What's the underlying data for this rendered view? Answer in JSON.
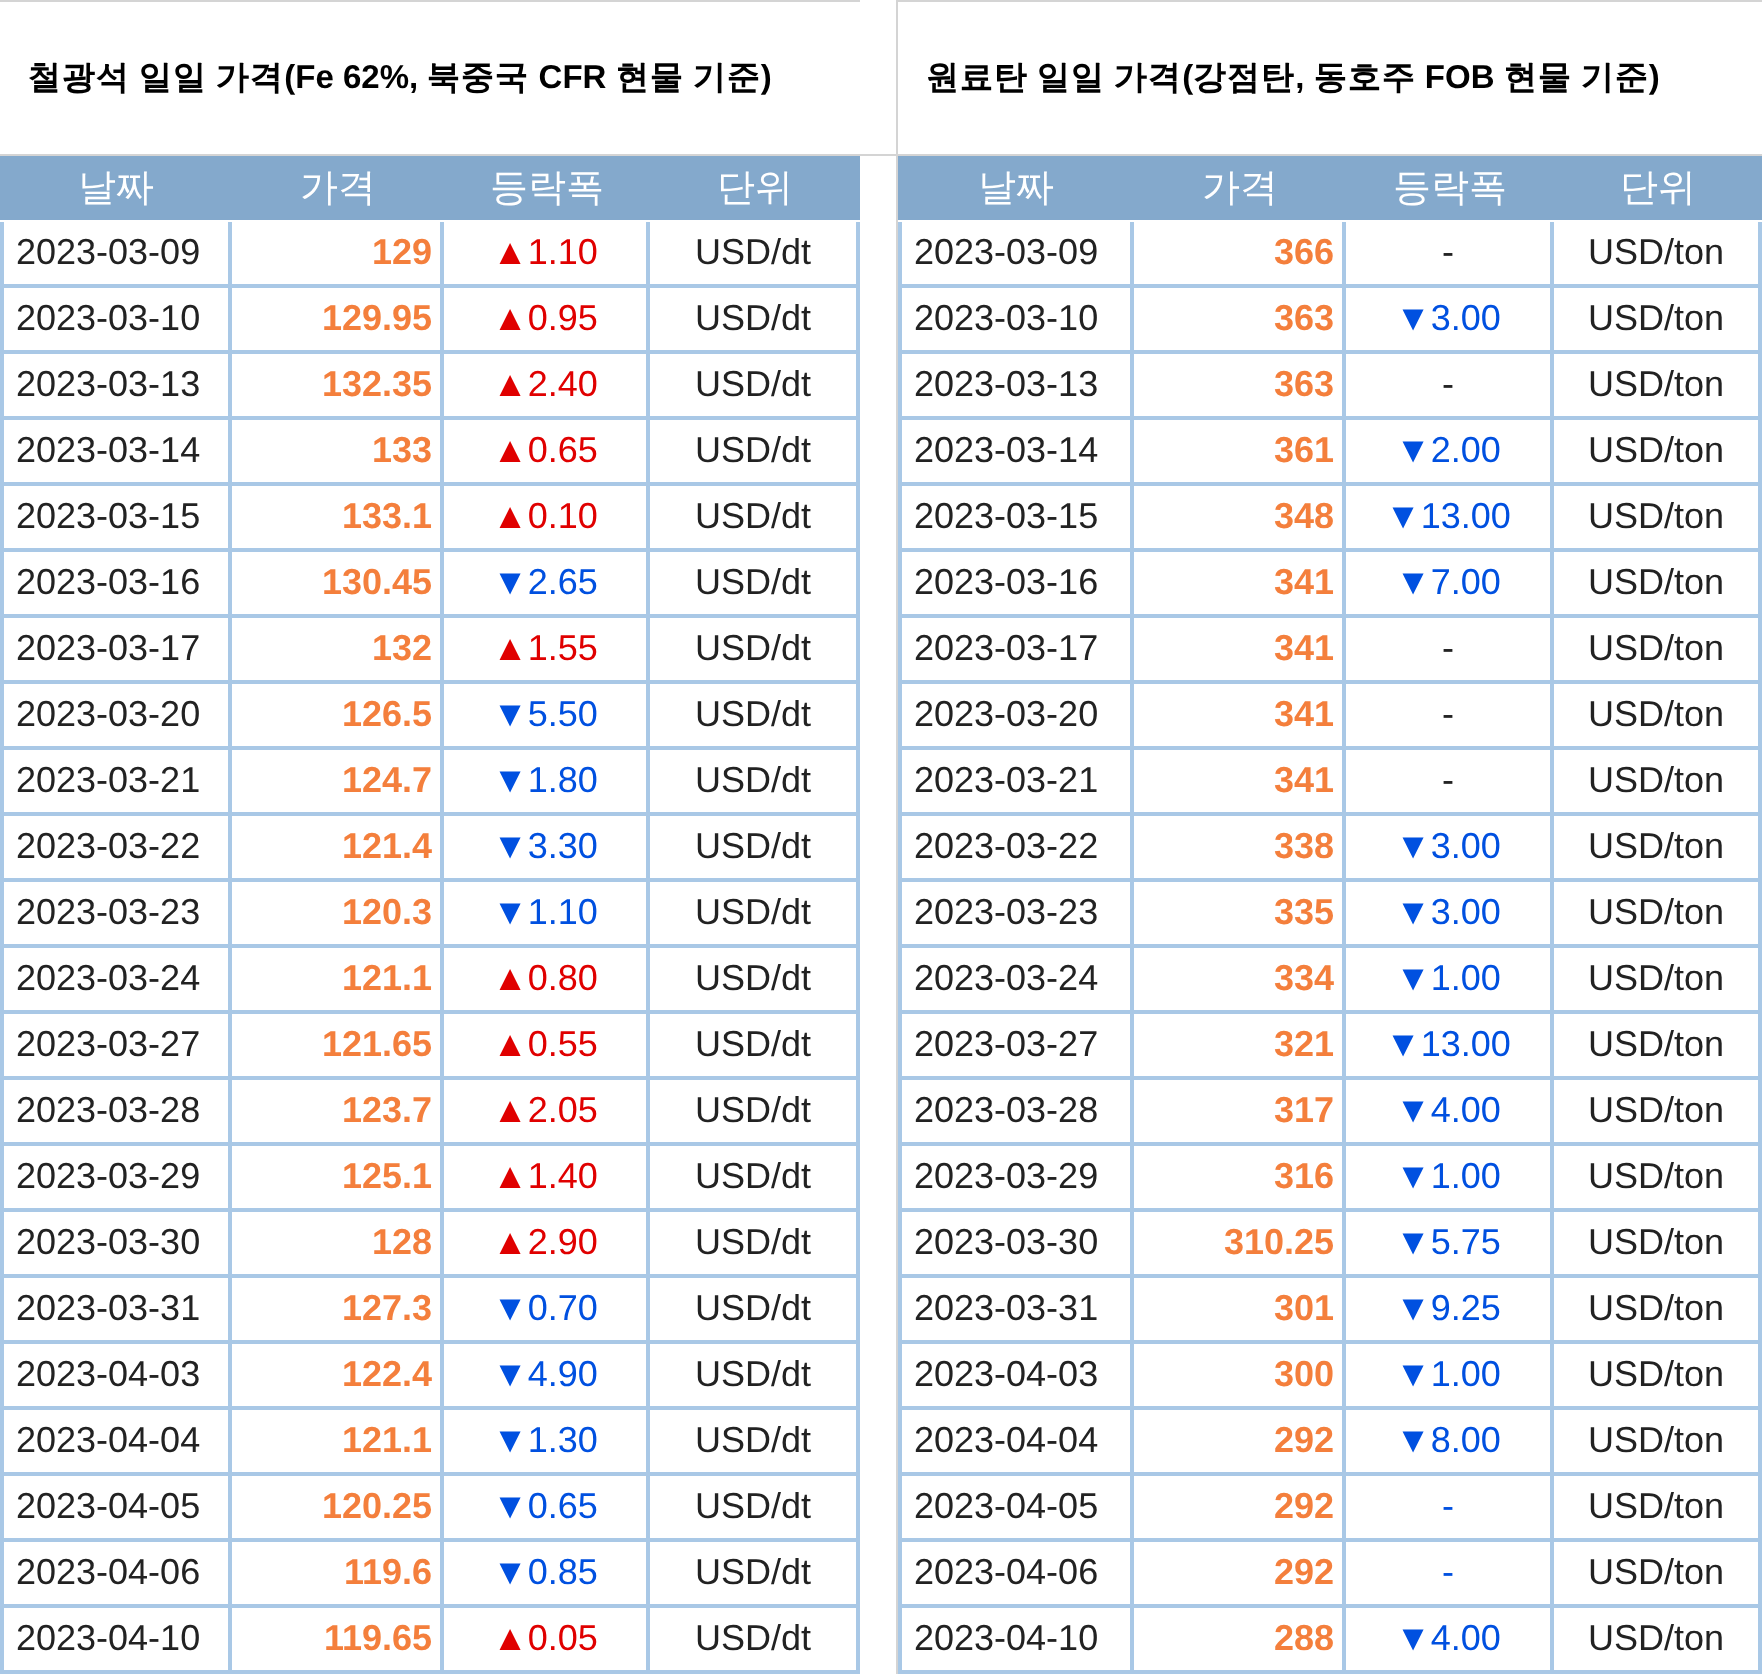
{
  "tables": [
    {
      "title": "철광석 일일 가격(Fe 62%, 북중국 CFR 현물 기준)",
      "columns": [
        "날짜",
        "가격",
        "등락폭",
        "단위"
      ],
      "rows": [
        {
          "date": "2023-03-09",
          "price": "129",
          "change": "▲1.10",
          "color": "#e00000",
          "unit": "USD/dt"
        },
        {
          "date": "2023-03-10",
          "price": "129.95",
          "change": "▲0.95",
          "color": "#e00000",
          "unit": "USD/dt"
        },
        {
          "date": "2023-03-13",
          "price": "132.35",
          "change": "▲2.40",
          "color": "#e00000",
          "unit": "USD/dt"
        },
        {
          "date": "2023-03-14",
          "price": "133",
          "change": "▲0.65",
          "color": "#e00000",
          "unit": "USD/dt"
        },
        {
          "date": "2023-03-15",
          "price": "133.1",
          "change": "▲0.10",
          "color": "#e00000",
          "unit": "USD/dt"
        },
        {
          "date": "2023-03-16",
          "price": "130.45",
          "change": "▼2.65",
          "color": "#0050e0",
          "unit": "USD/dt"
        },
        {
          "date": "2023-03-17",
          "price": "132",
          "change": "▲1.55",
          "color": "#e00000",
          "unit": "USD/dt"
        },
        {
          "date": "2023-03-20",
          "price": "126.5",
          "change": "▼5.50",
          "color": "#0050e0",
          "unit": "USD/dt"
        },
        {
          "date": "2023-03-21",
          "price": "124.7",
          "change": "▼1.80",
          "color": "#0050e0",
          "unit": "USD/dt"
        },
        {
          "date": "2023-03-22",
          "price": "121.4",
          "change": "▼3.30",
          "color": "#0050e0",
          "unit": "USD/dt"
        },
        {
          "date": "2023-03-23",
          "price": "120.3",
          "change": "▼1.10",
          "color": "#0050e0",
          "unit": "USD/dt"
        },
        {
          "date": "2023-03-24",
          "price": "121.1",
          "change": "▲0.80",
          "color": "#e00000",
          "unit": "USD/dt"
        },
        {
          "date": "2023-03-27",
          "price": "121.65",
          "change": "▲0.55",
          "color": "#e00000",
          "unit": "USD/dt"
        },
        {
          "date": "2023-03-28",
          "price": "123.7",
          "change": "▲2.05",
          "color": "#e00000",
          "unit": "USD/dt"
        },
        {
          "date": "2023-03-29",
          "price": "125.1",
          "change": "▲1.40",
          "color": "#e00000",
          "unit": "USD/dt"
        },
        {
          "date": "2023-03-30",
          "price": "128",
          "change": "▲2.90",
          "color": "#e00000",
          "unit": "USD/dt"
        },
        {
          "date": "2023-03-31",
          "price": "127.3",
          "change": "▼0.70",
          "color": "#0050e0",
          "unit": "USD/dt"
        },
        {
          "date": "2023-04-03",
          "price": "122.4",
          "change": "▼4.90",
          "color": "#0050e0",
          "unit": "USD/dt"
        },
        {
          "date": "2023-04-04",
          "price": "121.1",
          "change": "▼1.30",
          "color": "#0050e0",
          "unit": "USD/dt"
        },
        {
          "date": "2023-04-05",
          "price": "120.25",
          "change": "▼0.65",
          "color": "#0050e0",
          "unit": "USD/dt"
        },
        {
          "date": "2023-04-06",
          "price": "119.6",
          "change": "▼0.85",
          "color": "#0050e0",
          "unit": "USD/dt"
        },
        {
          "date": "2023-04-10",
          "price": "119.65",
          "change": "▲0.05",
          "color": "#e00000",
          "unit": "USD/dt"
        }
      ]
    },
    {
      "title": "원료탄 일일 가격(강점탄, 동호주 FOB 현물 기준)",
      "columns": [
        "날짜",
        "가격",
        "등락폭",
        "단위"
      ],
      "rows": [
        {
          "date": "2023-03-09",
          "price": "366",
          "change": "-",
          "color": "#222222",
          "unit": "USD/ton"
        },
        {
          "date": "2023-03-10",
          "price": "363",
          "change": "▼3.00",
          "color": "#0050e0",
          "unit": "USD/ton"
        },
        {
          "date": "2023-03-13",
          "price": "363",
          "change": "-",
          "color": "#222222",
          "unit": "USD/ton"
        },
        {
          "date": "2023-03-14",
          "price": "361",
          "change": "▼2.00",
          "color": "#0050e0",
          "unit": "USD/ton"
        },
        {
          "date": "2023-03-15",
          "price": "348",
          "change": "▼13.00",
          "color": "#0050e0",
          "unit": "USD/ton"
        },
        {
          "date": "2023-03-16",
          "price": "341",
          "change": "▼7.00",
          "color": "#0050e0",
          "unit": "USD/ton"
        },
        {
          "date": "2023-03-17",
          "price": "341",
          "change": "-",
          "color": "#222222",
          "unit": "USD/ton"
        },
        {
          "date": "2023-03-20",
          "price": "341",
          "change": "-",
          "color": "#222222",
          "unit": "USD/ton"
        },
        {
          "date": "2023-03-21",
          "price": "341",
          "change": "-",
          "color": "#222222",
          "unit": "USD/ton"
        },
        {
          "date": "2023-03-22",
          "price": "338",
          "change": "▼3.00",
          "color": "#0050e0",
          "unit": "USD/ton"
        },
        {
          "date": "2023-03-23",
          "price": "335",
          "change": "▼3.00",
          "color": "#0050e0",
          "unit": "USD/ton"
        },
        {
          "date": "2023-03-24",
          "price": "334",
          "change": "▼1.00",
          "color": "#0050e0",
          "unit": "USD/ton"
        },
        {
          "date": "2023-03-27",
          "price": "321",
          "change": "▼13.00",
          "color": "#0050e0",
          "unit": "USD/ton"
        },
        {
          "date": "2023-03-28",
          "price": "317",
          "change": "▼4.00",
          "color": "#0050e0",
          "unit": "USD/ton"
        },
        {
          "date": "2023-03-29",
          "price": "316",
          "change": "▼1.00",
          "color": "#0050e0",
          "unit": "USD/ton"
        },
        {
          "date": "2023-03-30",
          "price": "310.25",
          "change": "▼5.75",
          "color": "#0050e0",
          "unit": "USD/ton"
        },
        {
          "date": "2023-03-31",
          "price": "301",
          "change": "▼9.25",
          "color": "#0050e0",
          "unit": "USD/ton"
        },
        {
          "date": "2023-04-03",
          "price": "300",
          "change": "▼1.00",
          "color": "#0050e0",
          "unit": "USD/ton"
        },
        {
          "date": "2023-04-04",
          "price": "292",
          "change": "▼8.00",
          "color": "#0050e0",
          "unit": "USD/ton"
        },
        {
          "date": "2023-04-05",
          "price": "292",
          "change": "-",
          "color": "#0050e0",
          "unit": "USD/ton"
        },
        {
          "date": "2023-04-06",
          "price": "292",
          "change": "-",
          "color": "#0050e0",
          "unit": "USD/ton"
        },
        {
          "date": "2023-04-10",
          "price": "288",
          "change": "▼4.00",
          "color": "#0050e0",
          "unit": "USD/ton"
        }
      ]
    }
  ]
}
